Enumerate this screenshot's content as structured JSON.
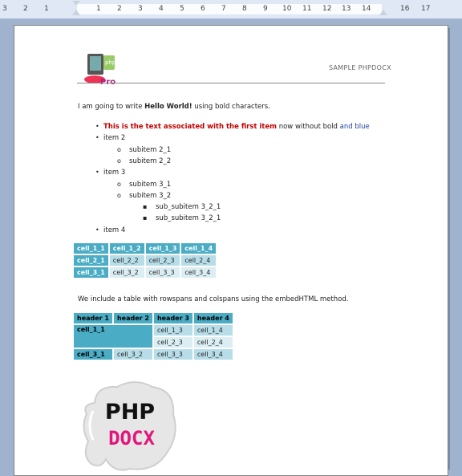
{
  "ruler": {
    "numbers": [
      "3",
      "2",
      "1",
      "1",
      "2",
      "3",
      "4",
      "5",
      "6",
      "7",
      "8",
      "9",
      "10",
      "11",
      "12",
      "13",
      "14",
      "16",
      "17"
    ]
  },
  "header": {
    "text": "SAMPLE PHPDOCX",
    "logo_text": "Pro"
  },
  "intro": {
    "before": "I am going to write ",
    "bold": "Hello World!",
    "after": " using bold characters."
  },
  "list": {
    "item1_red": "This is the text associated with the first item",
    "item1_plain": " now without bold ",
    "item1_blue": "and blue",
    "item2": "item 2",
    "sub2_1": "subitem 2_1",
    "sub2_2": "subitem 2_2",
    "item3": "item 3",
    "sub3_1": "subitem 3_1",
    "sub3_2": "subitem 3_2",
    "subsub1": "sub_subitem 3_2_1",
    "subsub2": "sub_subitem 3_2_1",
    "item4": "item 4",
    "bullet_1": "•",
    "bullet_2": "o",
    "bullet_3": "▪"
  },
  "table1": {
    "rows": [
      [
        "cell_1_1",
        "cell_1_2",
        "cell_1_3",
        "cell_1_4"
      ],
      [
        "cell_2_1",
        "cell_2_2",
        "cell_2_3",
        "cell_2_4"
      ],
      [
        "cell_3_1",
        "cell_3_2",
        "cell_3_3",
        "cell_3_4"
      ]
    ]
  },
  "para2": "We include a table with rowspans and colspans using the embedHTML method.",
  "table2": {
    "headers": [
      "header 1",
      "header 2",
      "header 3",
      "header 4"
    ],
    "r1c1": "cell_1_1",
    "r1c3": "cell_1_3",
    "r1c4": "cell_1_4",
    "r2c3": "cell_2_3",
    "r2c4": "cell_2_4",
    "r3": [
      "cell_3_1",
      "cell_3_2",
      "cell_3_3",
      "cell_3_4"
    ]
  },
  "biglogo": {
    "line1": "PHP",
    "line2": "DOCX"
  }
}
